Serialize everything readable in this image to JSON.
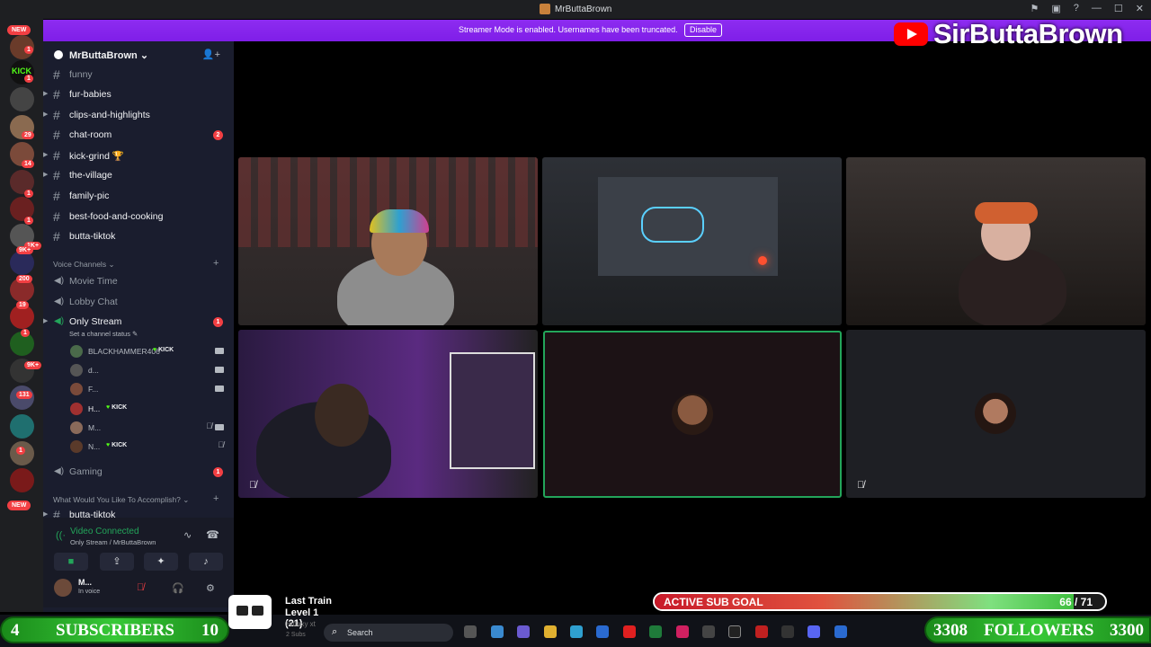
{
  "window": {
    "title": "MrButtaBrown"
  },
  "banner": {
    "message": "Streamer Mode is enabled. Usernames have been truncated.",
    "disable_label": "Disable"
  },
  "overlay": {
    "brand_name": "SirButtaBrown"
  },
  "server_rail": {
    "new_label": "NEW",
    "badges": [
      "1",
      "1",
      "29",
      "14",
      "1",
      "1",
      "1K+",
      "9K+",
      "200",
      "19",
      "1",
      "9K+",
      "131",
      "1"
    ],
    "new_bottom_label": "NEW"
  },
  "guild": {
    "name": "MrButtaBrown"
  },
  "text_channels": [
    {
      "name": "funny"
    },
    {
      "name": "fur-babies"
    },
    {
      "name": "clips-and-highlights"
    },
    {
      "name": "chat-room",
      "unread": "2"
    },
    {
      "name": "kick-grind 🏆"
    },
    {
      "name": "the-village"
    },
    {
      "name": "family-pic"
    },
    {
      "name": "best-food-and-cooking"
    },
    {
      "name": "butta-tiktok"
    }
  ],
  "voice_category": {
    "label": "Voice Channels"
  },
  "voice_channels": {
    "movie_time": "Movie Time",
    "lobby_chat": "Lobby Chat",
    "only_stream": {
      "name": "Only Stream",
      "unread": "1",
      "status_placeholder": "Set a channel status"
    },
    "gaming": {
      "name": "Gaming",
      "unread": "1"
    }
  },
  "voice_users": [
    {
      "name": "BLACKHAMMER406",
      "tag": "KICK"
    },
    {
      "name": "d..."
    },
    {
      "name": "F..."
    },
    {
      "name": "H...",
      "tag": "KICK"
    },
    {
      "name": "M..."
    },
    {
      "name": "N...",
      "tag": "KICK"
    }
  ],
  "category2": {
    "label": "What Would You Like To Accomplish?",
    "channel": "butta-tiktok"
  },
  "voice_connection": {
    "title": "Video Connected",
    "subtitle": "Only Stream / MrButtaBrown"
  },
  "user_panel": {
    "name": "M...",
    "status": "In voice"
  },
  "subscribers": {
    "current": "4",
    "label": "SUBSCRIBERS",
    "goal": "10"
  },
  "followers": {
    "current": "3308",
    "label": "FOLLOWERS",
    "goal": "3300"
  },
  "sub_goal": {
    "label": "ACTIVE SUB GOAL",
    "value": "66 / 71",
    "progress": 0.93
  },
  "train": {
    "title": "Last Train",
    "level": "Level 1  (21)",
    "line3": "Hittaxy xt",
    "line4": "2 Subs"
  },
  "taskbar": {
    "search_placeholder": "Search"
  },
  "colors": {
    "accent": "#8d2cf0",
    "unread": "#f23f43",
    "connected": "#23a55a",
    "kick_green": "#53fc18"
  }
}
